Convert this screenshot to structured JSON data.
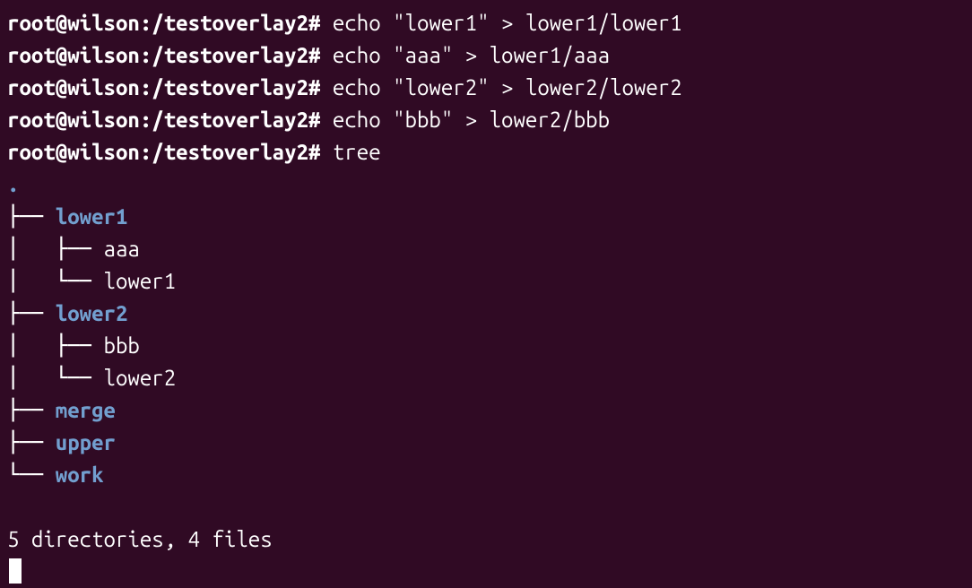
{
  "prompts": {
    "p1": "root@wilson:/testoverlay2# ",
    "p2": "root@wilson:/testoverlay2# ",
    "p3": "root@wilson:/testoverlay2# ",
    "p4": "root@wilson:/testoverlay2# ",
    "p5": "root@wilson:/testoverlay2# "
  },
  "commands": {
    "c1": "echo \"lower1\" > lower1/lower1",
    "c2": "echo \"aaa\" > lower1/aaa",
    "c3": "echo \"lower2\" > lower2/lower2",
    "c4": "echo \"bbb\" > lower2/bbb",
    "c5": "tree"
  },
  "tree": {
    "root": ".",
    "b_lower1": "├── ",
    "n_lower1": "lower1",
    "b_aaa": "│   ├── ",
    "n_aaa": "aaa",
    "b_lower1f": "│   └── ",
    "n_lower1f": "lower1",
    "b_lower2": "├── ",
    "n_lower2": "lower2",
    "b_bbb": "│   ├── ",
    "n_bbb": "bbb",
    "b_lower2f": "│   └── ",
    "n_lower2f": "lower2",
    "b_merge": "├── ",
    "n_merge": "merge",
    "b_upper": "├── ",
    "n_upper": "upper",
    "b_work": "└── ",
    "n_work": "work"
  },
  "summary": "5 directories, 4 files"
}
